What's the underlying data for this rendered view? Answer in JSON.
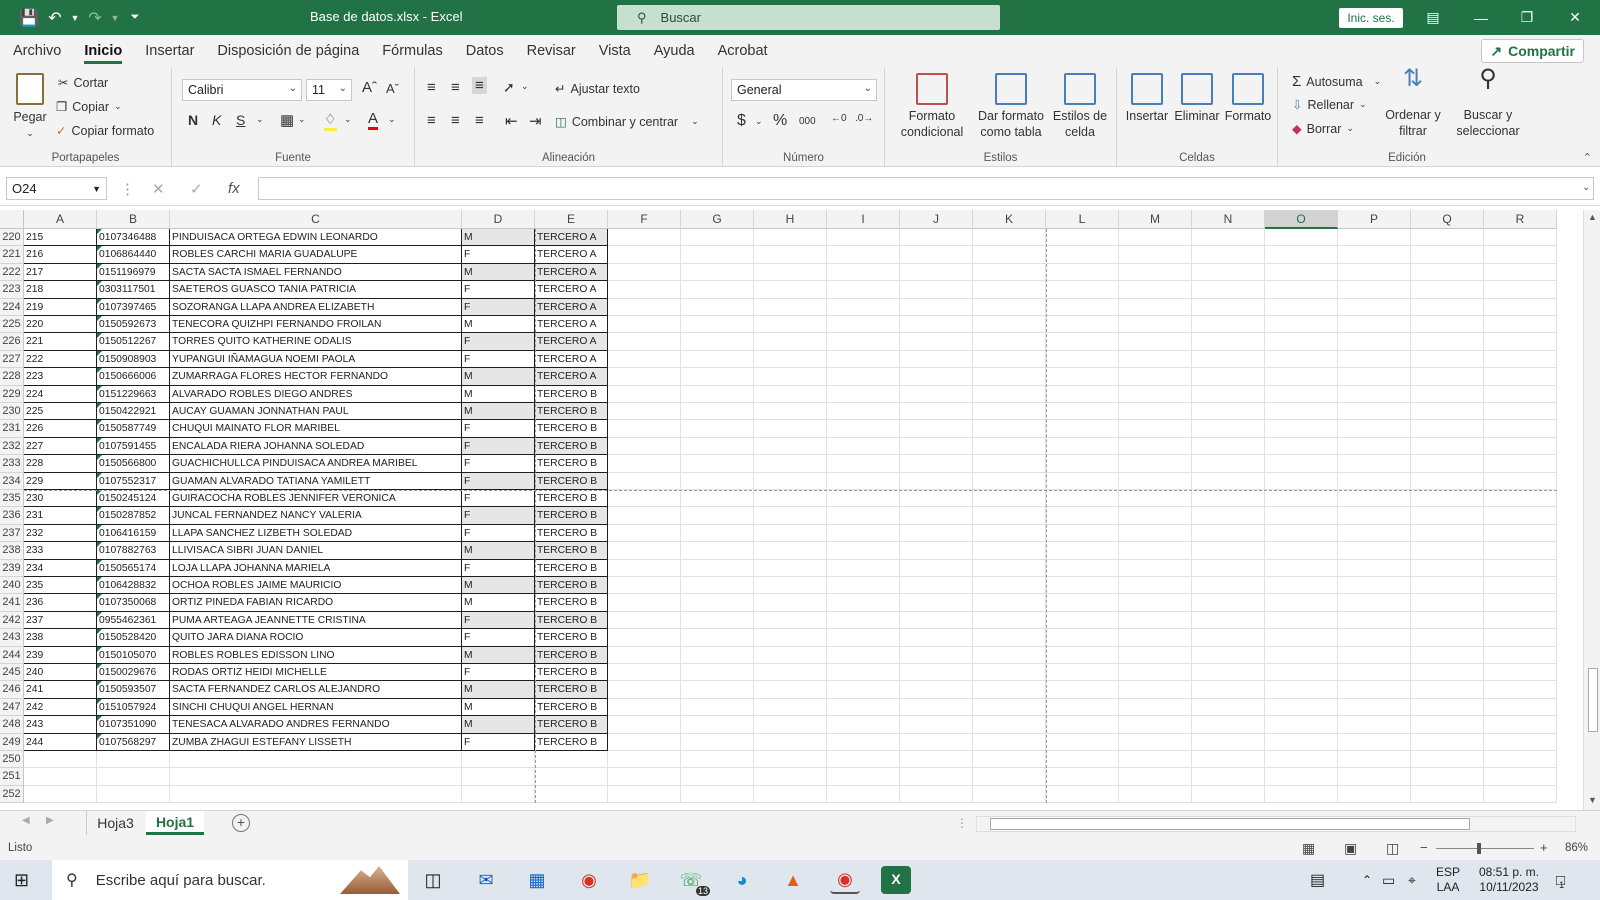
{
  "window": {
    "title": "Base de datos.xlsx - Excel",
    "search_placeholder": "Buscar",
    "signin_label": "Inic. ses."
  },
  "menu": {
    "tabs": [
      "Archivo",
      "Inicio",
      "Insertar",
      "Disposición de página",
      "Fórmulas",
      "Datos",
      "Revisar",
      "Vista",
      "Ayuda",
      "Acrobat"
    ],
    "active": "Inicio",
    "share_label": "Compartir"
  },
  "ribbon": {
    "clipboard": {
      "label": "Portapapeles",
      "paste": "Pegar",
      "cut": "Cortar",
      "copy": "Copiar",
      "format_painter": "Copiar formato"
    },
    "font": {
      "label": "Fuente",
      "name": "Calibri",
      "size": "11",
      "bold": "N",
      "italic": "K",
      "underline": "S"
    },
    "alignment": {
      "label": "Alineación",
      "wrap": "Ajustar texto",
      "merge": "Combinar y centrar"
    },
    "number": {
      "label": "Número",
      "format": "General"
    },
    "styles": {
      "label": "Estilos",
      "conditional": "Formato condicional",
      "as_table": "Dar formato como tabla",
      "cell_styles": "Estilos de celda"
    },
    "cells": {
      "label": "Celdas",
      "insert": "Insertar",
      "delete": "Eliminar",
      "format": "Formato"
    },
    "editing": {
      "label": "Edición",
      "autosum": "Autosuma",
      "fill": "Rellenar",
      "clear": "Borrar",
      "sort": "Ordenar y filtrar",
      "find": "Buscar y seleccionar"
    }
  },
  "formula_bar": {
    "name_box": "O24",
    "fx": "fx",
    "formula": ""
  },
  "columns": [
    "A",
    "B",
    "C",
    "D",
    "E",
    "F",
    "G",
    "H",
    "I",
    "J",
    "K",
    "L",
    "M",
    "N",
    "O",
    "P",
    "Q",
    "R"
  ],
  "selected_column": "O",
  "rows": [
    {
      "n": "220",
      "a": "215",
      "b": "0107346488",
      "c": "PINDUISACA ORTEGA EDWIN LEONARDO",
      "d": "M",
      "e": "TERCERO A"
    },
    {
      "n": "221",
      "a": "216",
      "b": "0106864440",
      "c": "ROBLES CARCHI MARIA GUADALUPE",
      "d": "F",
      "e": "TERCERO A"
    },
    {
      "n": "222",
      "a": "217",
      "b": "0151196979",
      "c": "SACTA SACTA ISMAEL FERNANDO",
      "d": "M",
      "e": "TERCERO A"
    },
    {
      "n": "223",
      "a": "218",
      "b": "0303117501",
      "c": "SAETEROS GUASCO TANIA PATRICIA",
      "d": "F",
      "e": "TERCERO A"
    },
    {
      "n": "224",
      "a": "219",
      "b": "0107397465",
      "c": "SOZORANGA LLAPA ANDREA ELIZABETH",
      "d": "F",
      "e": "TERCERO A"
    },
    {
      "n": "225",
      "a": "220",
      "b": "0150592673",
      "c": "TENECORA QUIZHPI FERNANDO FROILAN",
      "d": "M",
      "e": "TERCERO A"
    },
    {
      "n": "226",
      "a": "221",
      "b": "0150512267",
      "c": "TORRES QUITO KATHERINE ODALIS",
      "d": "F",
      "e": "TERCERO A"
    },
    {
      "n": "227",
      "a": "222",
      "b": "0150908903",
      "c": "YUPANGUI IÑAMAGUA NOEMI PAOLA",
      "d": "F",
      "e": "TERCERO A"
    },
    {
      "n": "228",
      "a": "223",
      "b": "0150666006",
      "c": "ZUMARRAGA FLORES HECTOR FERNANDO",
      "d": "M",
      "e": "TERCERO A"
    },
    {
      "n": "229",
      "a": "224",
      "b": "0151229663",
      "c": "ALVARADO ROBLES DIEGO ANDRES",
      "d": "M",
      "e": "TERCERO B"
    },
    {
      "n": "230",
      "a": "225",
      "b": "0150422921",
      "c": "AUCAY GUAMAN JONNATHAN PAUL",
      "d": "M",
      "e": "TERCERO B"
    },
    {
      "n": "231",
      "a": "226",
      "b": "0150587749",
      "c": "CHUQUI MAINATO FLOR MARIBEL",
      "d": "F",
      "e": "TERCERO B"
    },
    {
      "n": "232",
      "a": "227",
      "b": "0107591455",
      "c": "ENCALADA RIERA JOHANNA SOLEDAD",
      "d": "F",
      "e": "TERCERO B"
    },
    {
      "n": "233",
      "a": "228",
      "b": "0150566800",
      "c": "GUACHICHULLCA PINDUISACA ANDREA MARIBEL",
      "d": "F",
      "e": "TERCERO B"
    },
    {
      "n": "234",
      "a": "229",
      "b": "0107552317",
      "c": "GUAMAN ALVARADO TATIANA YAMILETT",
      "d": "F",
      "e": "TERCERO B"
    },
    {
      "n": "235",
      "a": "230",
      "b": "0150245124",
      "c": "GUIRACOCHA ROBLES JENNIFER VERONICA",
      "d": "F",
      "e": "TERCERO B"
    },
    {
      "n": "236",
      "a": "231",
      "b": "0150287852",
      "c": "JUNCAL FERNANDEZ NANCY VALERIA",
      "d": "F",
      "e": "TERCERO B"
    },
    {
      "n": "237",
      "a": "232",
      "b": "0106416159",
      "c": "LLAPA SANCHEZ LIZBETH SOLEDAD",
      "d": "F",
      "e": "TERCERO B"
    },
    {
      "n": "238",
      "a": "233",
      "b": "0107882763",
      "c": "LLIVISACA SIBRI JUAN DANIEL",
      "d": "M",
      "e": "TERCERO B"
    },
    {
      "n": "239",
      "a": "234",
      "b": "0150565174",
      "c": "LOJA LLAPA JOHANNA MARIELA",
      "d": "F",
      "e": "TERCERO B"
    },
    {
      "n": "240",
      "a": "235",
      "b": "0106428832",
      "c": "OCHOA ROBLES JAIME MAURICIO",
      "d": "M",
      "e": "TERCERO B"
    },
    {
      "n": "241",
      "a": "236",
      "b": "0107350068",
      "c": "ORTIZ PINEDA FABIAN RICARDO",
      "d": "M",
      "e": "TERCERO B"
    },
    {
      "n": "242",
      "a": "237",
      "b": "0955462361",
      "c": "PUMA ARTEAGA JEANNETTE CRISTINA",
      "d": "F",
      "e": "TERCERO B"
    },
    {
      "n": "243",
      "a": "238",
      "b": "0150528420",
      "c": "QUITO JARA DIANA ROCIO",
      "d": "F",
      "e": "TERCERO B"
    },
    {
      "n": "244",
      "a": "239",
      "b": "0150105070",
      "c": "ROBLES ROBLES EDISSON LINO",
      "d": "M",
      "e": "TERCERO B"
    },
    {
      "n": "245",
      "a": "240",
      "b": "0150029676",
      "c": "RODAS ORTIZ HEIDI MICHELLE",
      "d": "F",
      "e": "TERCERO B"
    },
    {
      "n": "246",
      "a": "241",
      "b": "0150593507",
      "c": "SACTA FERNANDEZ CARLOS ALEJANDRO",
      "d": "M",
      "e": "TERCERO B"
    },
    {
      "n": "247",
      "a": "242",
      "b": "0151057924",
      "c": "SINCHI CHUQUI ANGEL HERNAN",
      "d": "M",
      "e": "TERCERO B"
    },
    {
      "n": "248",
      "a": "243",
      "b": "0107351090",
      "c": "TENESACA ALVARADO ANDRES FERNANDO",
      "d": "M",
      "e": "TERCERO B"
    },
    {
      "n": "249",
      "a": "244",
      "b": "0107568297",
      "c": "ZUMBA ZHAGUI ESTEFANY LISSETH",
      "d": "F",
      "e": "TERCERO B"
    }
  ],
  "empty_rows": [
    "250",
    "251",
    "252"
  ],
  "sheet_tabs": [
    "Hoja3",
    "Hoja1"
  ],
  "active_sheet": "Hoja1",
  "status": {
    "ready": "Listo",
    "zoom": "86%"
  },
  "taskbar": {
    "search_placeholder": "Escribe aquí para buscar.",
    "whatsapp_badge": "13",
    "lang": "ESP",
    "layout": "LAA",
    "time": "08:51 p. m.",
    "date": "10/11/2023",
    "notif_count": "1"
  },
  "colors": {
    "excel_green": "#217346",
    "table_shade": "#e6e6e6",
    "chip_red": "#c0504d"
  }
}
